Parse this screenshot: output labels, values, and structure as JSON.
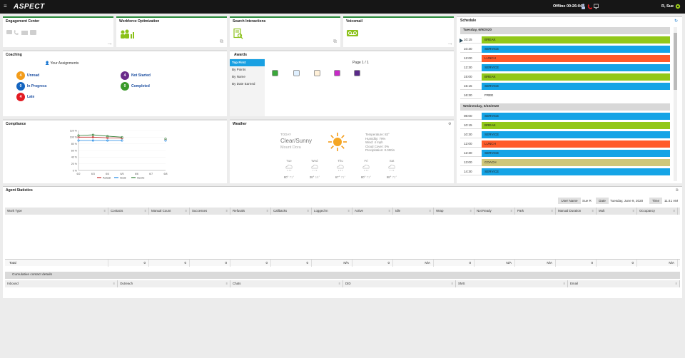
{
  "header": {
    "menu_icon": "hamburger-icon",
    "logo": "ASPECT",
    "status": "Offline",
    "timer": "00:26:04",
    "user": "R, Sue",
    "colors": {
      "bar": "#161616",
      "accent": "#9ccc1a"
    }
  },
  "tiles": {
    "engagement": {
      "title": "Engagement Center"
    },
    "workforce": {
      "title": "Workforce Optimization"
    },
    "search": {
      "title": "Search Interactions"
    },
    "voicemail": {
      "title": "Voicemail"
    }
  },
  "coaching": {
    "title": "Coaching",
    "assignments_label": "Your Assignments",
    "items": [
      {
        "count": "4",
        "label": "Unread",
        "color": "#f39c1a"
      },
      {
        "count": "4",
        "label": "Not Started",
        "color": "#6a2a8a"
      },
      {
        "count": "0",
        "label": "In Progress",
        "color": "#1565c0"
      },
      {
        "count": "0",
        "label": "Completed",
        "color": "#3a9a2a"
      },
      {
        "count": "4",
        "label": "Late",
        "color": "#e31b23"
      }
    ]
  },
  "awards": {
    "title": "Awards",
    "filters": [
      "Top First",
      "By Points",
      "By Name",
      "By Date Earned"
    ],
    "page": "Page 1 / 1"
  },
  "compliance": {
    "title": "Compliance",
    "legend": [
      "Actual",
      "Goal",
      "Score"
    ],
    "legend_colors": [
      "#c62828",
      "#1e88e5",
      "#2e7d32"
    ]
  },
  "chart_data": {
    "type": "line",
    "x": [
      "6/2",
      "6/3",
      "6/4",
      "6/5",
      "6/6",
      "6/7",
      "6/8"
    ],
    "series": [
      {
        "name": "Actual",
        "values": [
          100,
          100,
          98,
          97,
          null,
          null,
          92
        ]
      },
      {
        "name": "Goal",
        "values": [
          90,
          90,
          90,
          90,
          null,
          null,
          90
        ]
      },
      {
        "name": "Score",
        "values": [
          105,
          107,
          103,
          100,
          null,
          null,
          95
        ]
      }
    ],
    "yticks": [
      "0 %",
      "20 %",
      "40 %",
      "60 %",
      "80 %",
      "100 %",
      "120 %"
    ],
    "ylim": [
      0,
      120
    ]
  },
  "weather": {
    "title": "Weather",
    "day": "TODAY",
    "condition": "Clear/Sunny",
    "location": "Mount Dora",
    "details": [
      "Temperature: 83°",
      "Humidity: 79%",
      "Wind: 4 mph",
      "Cloud Cover: 0%",
      "Precipitation: 0.000in"
    ],
    "forecast": [
      {
        "day": "Tue",
        "hi": "80°",
        "lo": "71°"
      },
      {
        "day": "Wed",
        "hi": "38°",
        "lo": "15°"
      },
      {
        "day": "Thu",
        "hi": "67°",
        "lo": "71°"
      },
      {
        "day": "Fri",
        "hi": "80°",
        "lo": "71°"
      },
      {
        "day": "Sat",
        "hi": "98°",
        "lo": "72°"
      }
    ]
  },
  "schedule": {
    "title": "Schedule",
    "days": [
      {
        "date": "Tuesday, 6/9/2020",
        "rows": [
          {
            "time": "10:15",
            "label": "BREAK",
            "color": "#92c81a"
          },
          {
            "time": "10:30",
            "label": "SERVICE",
            "color": "#15a4e6"
          },
          {
            "time": "12:00",
            "label": "LUNCH",
            "color": "#ff5a2a"
          },
          {
            "time": "12:30",
            "label": "SERVICE",
            "color": "#15a4e6"
          },
          {
            "time": "15:00",
            "label": "BREAK",
            "color": "#92c81a"
          },
          {
            "time": "15:15",
            "label": "SERVICE",
            "color": "#15a4e6"
          },
          {
            "time": "16:30",
            "label": "FREE",
            "color": "#ffffff"
          }
        ]
      },
      {
        "date": "Wednesday, 6/10/2020",
        "rows": [
          {
            "time": "08:00",
            "label": "SERVICE",
            "color": "#15a4e6"
          },
          {
            "time": "10:15",
            "label": "BREAK",
            "color": "#92c81a"
          },
          {
            "time": "10:30",
            "label": "SERVICE",
            "color": "#15a4e6"
          },
          {
            "time": "12:00",
            "label": "LUNCH",
            "color": "#ff5a2a"
          },
          {
            "time": "12:30",
            "label": "SERVICE",
            "color": "#15a4e6"
          },
          {
            "time": "13:00",
            "label": "COACH",
            "color": "#cfc77a"
          },
          {
            "time": "14:30",
            "label": "SERVICE",
            "color": "#15a4e6"
          }
        ]
      }
    ]
  },
  "agent": {
    "title": "Agent Statistics",
    "username_label": "User Name",
    "username": "Sue R",
    "date_label": "Date",
    "date": "Tuesday, June 9, 2020",
    "time_label": "Time",
    "time": "11:41 AM",
    "columns": [
      "Work Type",
      "Contacts",
      "Manual Count",
      "Successes",
      "Refusals",
      "Callbacks",
      "Logged In",
      "Active",
      "Idle",
      "Wrap",
      "Not Ready",
      "Park",
      "Manual Duration",
      "Mult",
      "Occupancy"
    ],
    "total_label": "Total",
    "totals": [
      "0",
      "0",
      "0",
      "0",
      "0",
      "N/A",
      "0",
      "N/A",
      "0",
      "N/A",
      "N/A",
      "0",
      "0",
      "N/A"
    ],
    "cumulative_title": "Cumulative contact details",
    "cumulative_cols": [
      "Inbound",
      "Outreach",
      "Chats",
      "DID",
      "SMS",
      "Email"
    ]
  }
}
